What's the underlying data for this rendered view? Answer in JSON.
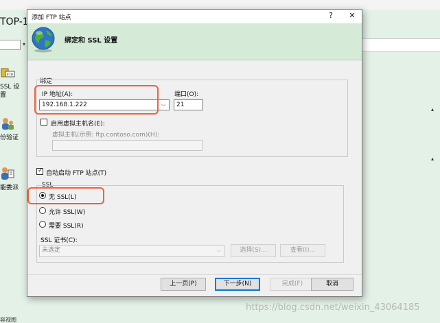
{
  "background": {
    "title": "TOP-1",
    "items": [
      {
        "label": "SSL 设\n置"
      },
      {
        "label": "份验证"
      },
      {
        "label": "能委派"
      }
    ],
    "bottom_label": "容视图"
  },
  "dialog": {
    "title": "添加 FTP 站点",
    "help_glyph": "?",
    "close_glyph": "✕",
    "header": "绑定和 SSL 设置",
    "binding": {
      "group_label": "绑定",
      "ip_label": "IP 地址(A):",
      "ip_value": "192.168.1.222",
      "port_label": "端口(O):",
      "port_value": "21",
      "virtual_host_checkbox": "启用虚拟主机名(E):",
      "virtual_host_checked": false,
      "virtual_host_label": "虚拟主机(示例: ftp.contoso.com)(H):",
      "virtual_host_value": ""
    },
    "autostart_label": "自动启动 FTP 站点(T)",
    "autostart_checked": true,
    "ssl": {
      "group_label": "SSL",
      "options": [
        {
          "label": "无 SSL(L)",
          "selected": true
        },
        {
          "label": "允许 SSL(W)",
          "selected": false
        },
        {
          "label": "需要 SSL(R)",
          "selected": false
        }
      ],
      "cert_label": "SSL 证书(C):",
      "cert_value": "未选定",
      "select_button": "选择(S)...",
      "view_button": "查看(I)..."
    },
    "buttons": {
      "prev": "上一页(P)",
      "next": "下一步(N)",
      "finish": "完成(F)",
      "cancel": "取消"
    }
  },
  "watermark": "https://blog.csdn.net/weixin_43064185",
  "colors": {
    "highlight": "#f0603a",
    "header_bg": "#d6ead8",
    "accent": "#0078d7"
  }
}
